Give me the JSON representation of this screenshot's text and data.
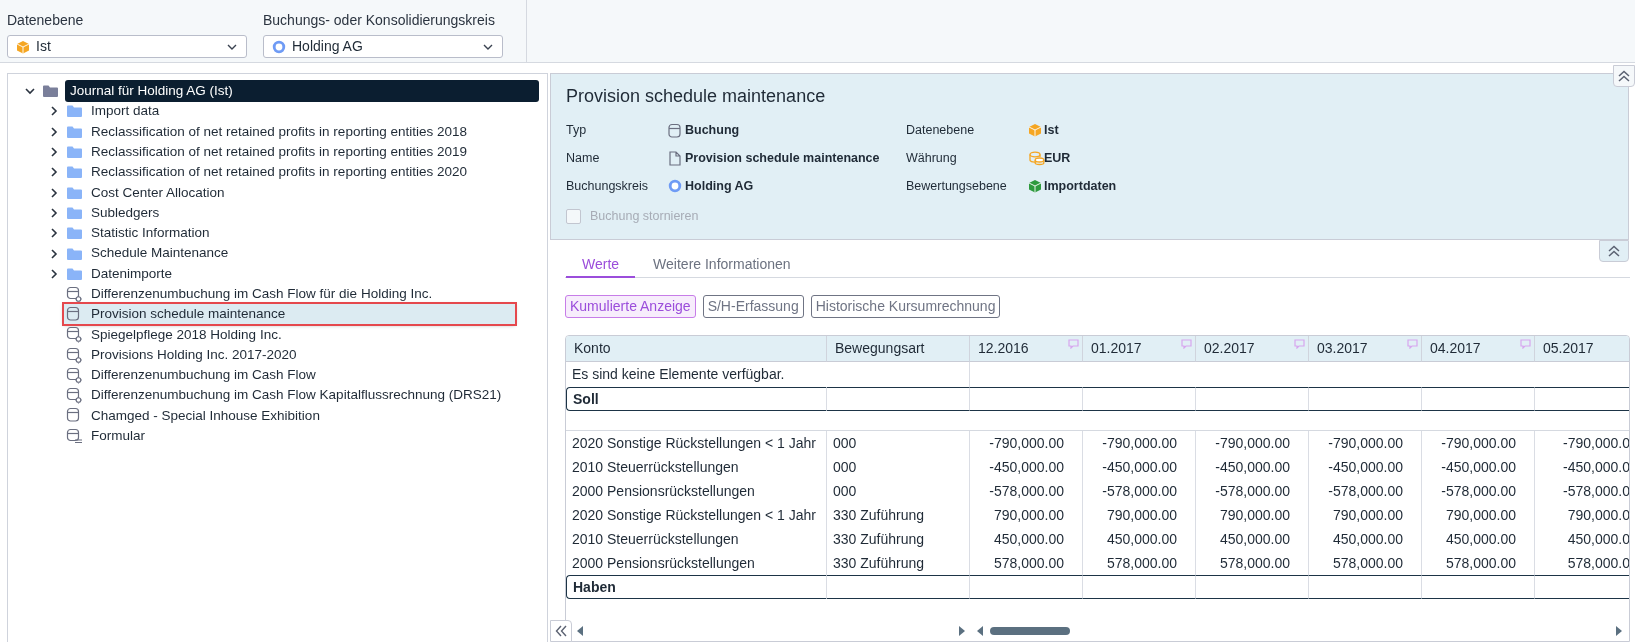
{
  "filters": [
    {
      "label": "Datenebene",
      "value": "Ist",
      "kind": "cube",
      "color": "#f5a623"
    },
    {
      "label": "Buchungs- oder Konsolidierungskreis",
      "value": "Holding AG",
      "kind": "ring"
    }
  ],
  "tree": {
    "label": "Journal für Holding AG (Ist)",
    "kind": "folder",
    "expanded": true,
    "selected": true,
    "outlined": false,
    "children": [
      {
        "label": "Import data",
        "kind": "folder",
        "expanded": false,
        "selected": false,
        "outlined": false
      },
      {
        "label": "Reclassification of net retained profits in reporting entities 2018",
        "kind": "folder",
        "expanded": false,
        "selected": false,
        "outlined": false
      },
      {
        "label": "Reclassification of net retained profits in reporting entities 2019",
        "kind": "folder",
        "expanded": false,
        "selected": false,
        "outlined": false
      },
      {
        "label": "Reclassification of net retained profits in reporting entities 2020",
        "kind": "folder",
        "expanded": false,
        "selected": false,
        "outlined": false
      },
      {
        "label": "Cost Center Allocation",
        "kind": "folder",
        "expanded": false,
        "selected": false,
        "outlined": false
      },
      {
        "label": "Subledgers",
        "kind": "folder",
        "expanded": false,
        "selected": false,
        "outlined": false
      },
      {
        "label": "Statistic Information",
        "kind": "folder",
        "expanded": false,
        "selected": false,
        "outlined": false
      },
      {
        "label": "Schedule Maintenance",
        "kind": "folder",
        "expanded": false,
        "selected": false,
        "outlined": false
      },
      {
        "label": "Datenimporte",
        "kind": "folder",
        "expanded": false,
        "selected": false,
        "outlined": false
      },
      {
        "label": "Differenzenumbuchung im Cash Flow für die Holding Inc.",
        "kind": "recurring",
        "selected": false,
        "outlined": false
      },
      {
        "label": "Provision schedule maintenance",
        "kind": "single",
        "selected": true,
        "outlined": true
      },
      {
        "label": "Spiegelpflege 2018 Holding Inc.",
        "kind": "recurring",
        "selected": false,
        "outlined": false
      },
      {
        "label": "Provisions Holding Inc. 2017-2020",
        "kind": "recurring",
        "selected": false,
        "outlined": false
      },
      {
        "label": "Differenzenumbuchung im Cash Flow",
        "kind": "recurring",
        "selected": false,
        "outlined": false
      },
      {
        "label": "Differenzenumbuchung im Cash Flow Kapitalflussrechnung (DRS21)",
        "kind": "recurring",
        "selected": false,
        "outlined": false
      },
      {
        "label": "Chamged - Special Inhouse Exhibition",
        "kind": "single",
        "selected": false,
        "outlined": false
      },
      {
        "label": "Formular",
        "kind": "form",
        "selected": false,
        "outlined": false
      }
    ]
  },
  "details": {
    "title": "Provision schedule maintenance",
    "fields": [
      {
        "label": "Typ",
        "value": "Buchung",
        "kind": "posting"
      },
      {
        "label": "Datenebene",
        "value": "Ist",
        "kind": "cube",
        "color": "#f5a623"
      },
      {
        "label": "Name",
        "value": "Provision schedule maintenance",
        "kind": "document"
      },
      {
        "label": "Währung",
        "value": "EUR",
        "kind": "coins"
      },
      {
        "label": "Buchungskreis",
        "value": "Holding AG",
        "kind": "ring"
      },
      {
        "label": "Bewertungsebene",
        "value": "Importdaten",
        "kind": "cube",
        "color": "#2e9a3e"
      }
    ],
    "checkbox": {
      "label": "Buchung stornieren",
      "checked": false,
      "disabled": true
    }
  },
  "tabs": [
    {
      "label": "Werte",
      "selected": true
    },
    {
      "label": "Weitere Informationen",
      "selected": false
    }
  ],
  "toggles": [
    {
      "label": "Kumulierte Anzeige",
      "active": true
    },
    {
      "label": "S/H-Erfassung",
      "active": false
    },
    {
      "label": "Historische Kursumrechnung",
      "active": false
    }
  ],
  "table": {
    "columns": [
      {
        "label": "Konto"
      },
      {
        "label": "Bewegungsart"
      },
      {
        "label": "12.2016",
        "note": true
      },
      {
        "label": "01.2017",
        "note": true
      },
      {
        "label": "02.2017",
        "note": true
      },
      {
        "label": "03.2017",
        "note": true
      },
      {
        "label": "04.2017",
        "note": true
      },
      {
        "label": "05.2017",
        "note": false
      }
    ],
    "rows": [
      {
        "kind": "message",
        "text": "Es sind keine Elemente verfügbar."
      },
      {
        "kind": "group",
        "text": "Soll"
      },
      {
        "kind": "spacer"
      },
      {
        "kind": "data",
        "konto": "2020 Sonstige Rückstellungen < 1 Jahr",
        "bewegungsart": "000",
        "values": [
          "-790,000.00",
          "-790,000.00",
          "-790,000.00",
          "-790,000.00",
          "-790,000.00",
          "-790,000.0"
        ]
      },
      {
        "kind": "data",
        "konto": "2010 Steuerrückstellungen",
        "bewegungsart": "000",
        "values": [
          "-450,000.00",
          "-450,000.00",
          "-450,000.00",
          "-450,000.00",
          "-450,000.00",
          "-450,000.0"
        ]
      },
      {
        "kind": "data",
        "konto": "2000 Pensionsrückstellungen",
        "bewegungsart": "000",
        "values": [
          "-578,000.00",
          "-578,000.00",
          "-578,000.00",
          "-578,000.00",
          "-578,000.00",
          "-578,000.0"
        ]
      },
      {
        "kind": "data",
        "konto": "2020 Sonstige Rückstellungen < 1 Jahr",
        "bewegungsart": "330 Zuführung",
        "values": [
          "790,000.00",
          "790,000.00",
          "790,000.00",
          "790,000.00",
          "790,000.00",
          "790,000.0"
        ]
      },
      {
        "kind": "data",
        "konto": "2010 Steuerrückstellungen",
        "bewegungsart": "330 Zuführung",
        "values": [
          "450,000.00",
          "450,000.00",
          "450,000.00",
          "450,000.00",
          "450,000.00",
          "450,000.0"
        ]
      },
      {
        "kind": "data",
        "konto": "2000 Pensionsrückstellungen",
        "bewegungsart": "330 Zuführung",
        "values": [
          "578,000.00",
          "578,000.00",
          "578,000.00",
          "578,000.00",
          "578,000.00",
          "578,000.0"
        ]
      },
      {
        "kind": "group",
        "text": "Haben"
      }
    ]
  }
}
